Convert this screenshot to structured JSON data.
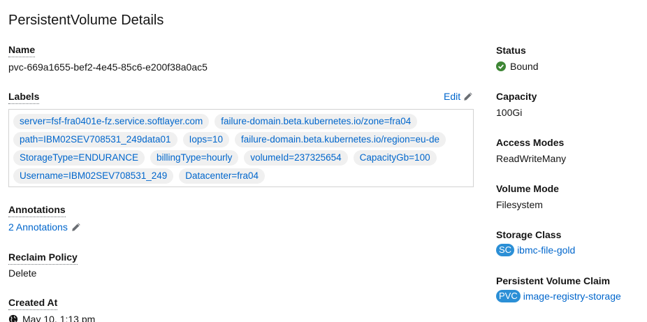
{
  "page": {
    "title": "PersistentVolume Details"
  },
  "left": {
    "name_label": "Name",
    "name_value": "pvc-669a1655-bef2-4e45-85c6-e200f38a0ac5",
    "labels_label": "Labels",
    "edit_label": "Edit",
    "labels_rows": [
      [
        "server=fsf-fra0401e-fz.service.softlayer.com",
        "failure-domain.beta.kubernetes.io/zone=fra04"
      ],
      [
        "path=IBM02SEV708531_249data01",
        "Iops=10",
        "failure-domain.beta.kubernetes.io/region=eu-de"
      ],
      [
        "StorageType=ENDURANCE",
        "billingType=hourly",
        "volumeId=237325654",
        "CapacityGb=100"
      ],
      [
        "Username=IBM02SEV708531_249",
        "Datacenter=fra04"
      ]
    ],
    "annotations_label": "Annotations",
    "annotations_link": "2 Annotations",
    "reclaim_label": "Reclaim Policy",
    "reclaim_value": "Delete",
    "created_label": "Created At",
    "created_value": "May 10, 1:13 pm"
  },
  "right": {
    "status_label": "Status",
    "status_value": "Bound",
    "capacity_label": "Capacity",
    "capacity_value": "100Gi",
    "access_label": "Access Modes",
    "access_value": "ReadWriteMany",
    "volume_mode_label": "Volume Mode",
    "volume_mode_value": "Filesystem",
    "storage_class_label": "Storage Class",
    "storage_class_badge": "SC",
    "storage_class_value": "ibmc-file-gold",
    "pvc_label": "Persistent Volume Claim",
    "pvc_badge": "PVC",
    "pvc_value": "image-registry-storage"
  },
  "colors": {
    "link": "#0066cc",
    "success": "#3e8635",
    "badge": "#2b8fd6",
    "chip_bg": "#f0f0f0"
  },
  "icons": {
    "edit": "pencil-icon",
    "status": "check-circle-icon",
    "created": "globe-icon"
  }
}
